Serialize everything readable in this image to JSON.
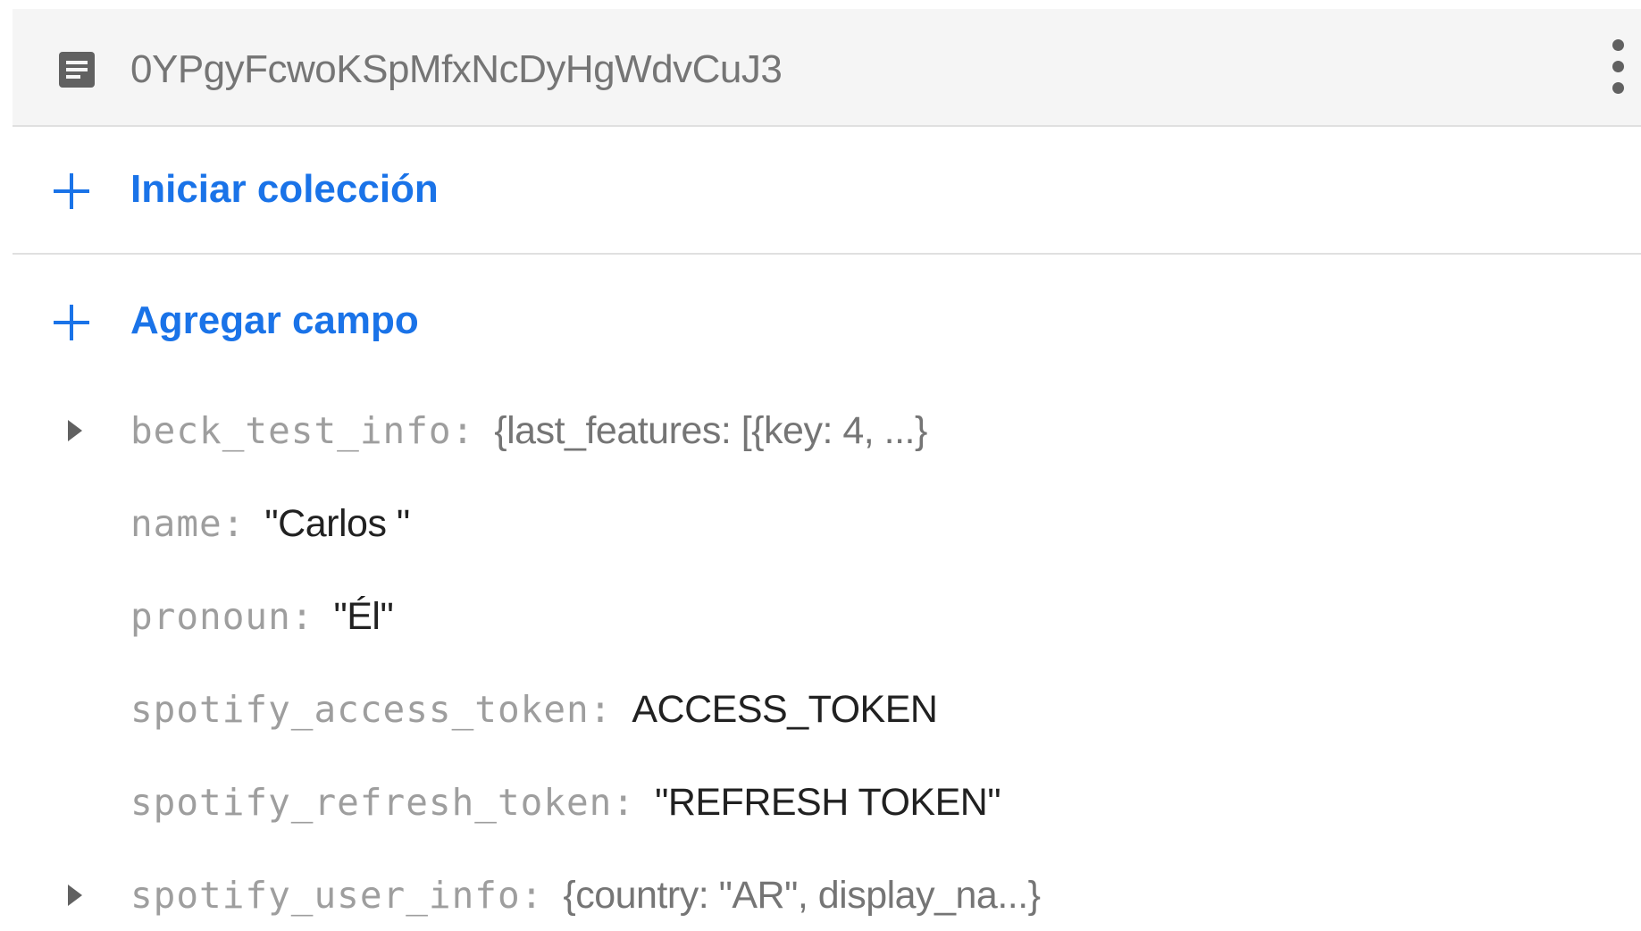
{
  "document": {
    "id": "0YPgyFcwoKSpMfxNcDyHgWdvCuJ3"
  },
  "actions": {
    "start_collection": "Iniciar colección",
    "add_field": "Agregar campo"
  },
  "fields": [
    {
      "key": "beck_test_info:",
      "value": "{last_features: [{key: 4, ...}",
      "expandable": true
    },
    {
      "key": "name:",
      "value": "\"Carlos \"",
      "expandable": false
    },
    {
      "key": "pronoun:",
      "value": "\"Él\"",
      "expandable": false
    },
    {
      "key": "spotify_access_token:",
      "value": "ACCESS_TOKEN",
      "expandable": false
    },
    {
      "key": "spotify_refresh_token:",
      "value": "\"REFRESH TOKEN\"",
      "expandable": false
    },
    {
      "key": "spotify_user_info:",
      "value": "{country: \"AR\", display_na...}",
      "expandable": true
    }
  ],
  "icons": {
    "document": "document-icon",
    "more": "more-vert-icon",
    "add": "plus-icon",
    "expand": "triangle-right-icon"
  },
  "colors": {
    "accent": "#1a73e8",
    "header_bg": "#f5f5f5",
    "key_text": "#9e9e9e",
    "value_text": "#212121"
  }
}
